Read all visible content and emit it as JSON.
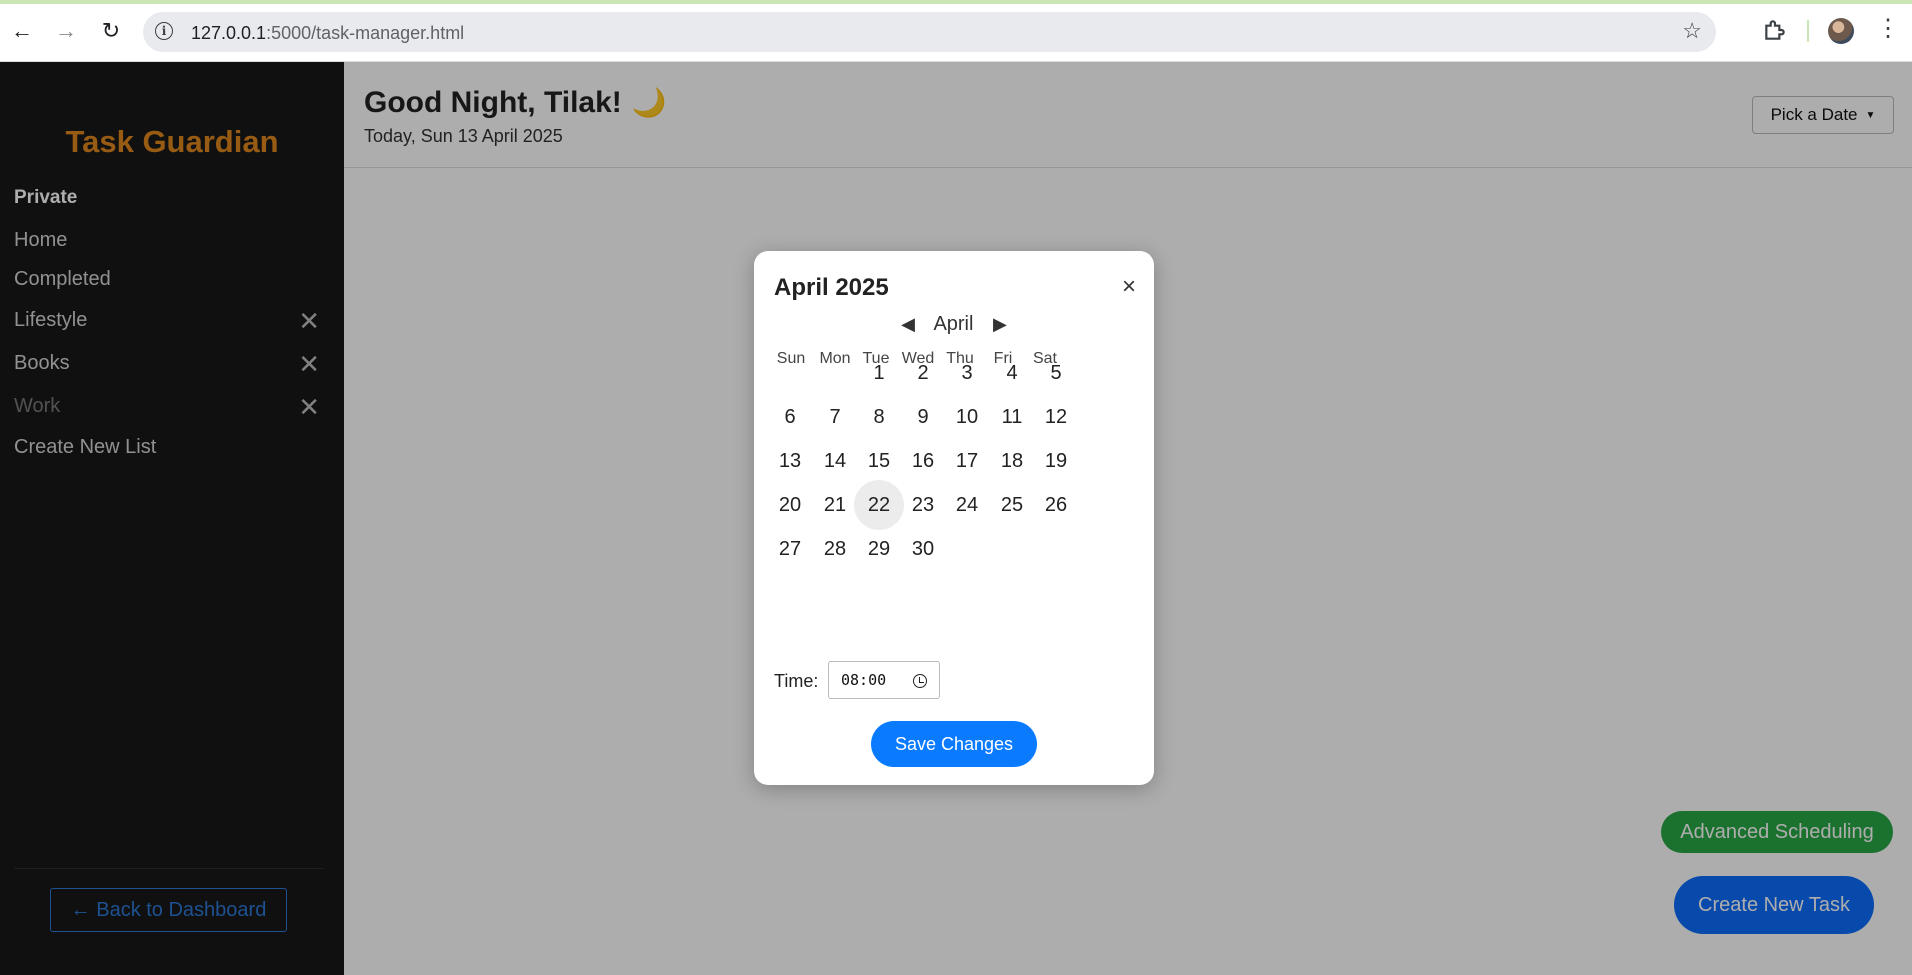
{
  "browser": {
    "url_host": "127.0.0.1",
    "url_path": ":5000/task-manager.html",
    "icons": [
      "back-arrow-icon",
      "forward-arrow-icon",
      "reload-icon",
      "site-info-icon",
      "bookmark-star-icon",
      "extensions-icon",
      "profile-avatar",
      "menu-kebab-icon"
    ]
  },
  "sidebar": {
    "brand": "Task Guardian",
    "section_heading": "Private",
    "items": [
      {
        "label": "Home",
        "removable": false
      },
      {
        "label": "Completed",
        "removable": false
      },
      {
        "label": "Lifestyle",
        "removable": true
      },
      {
        "label": "Books",
        "removable": true
      },
      {
        "label": "Work",
        "removable": true
      },
      {
        "label": "Create New List",
        "removable": false
      }
    ],
    "remove_glyph": "✕",
    "back_button": "← Back to Dashboard"
  },
  "header": {
    "greeting": "Good Night, Tilak!",
    "greeting_icon": "🌙",
    "date_line": "Today, Sun 13 April 2025",
    "pick_date_label": "Pick a Date"
  },
  "actions": {
    "advanced_scheduling": "Advanced Scheduling",
    "create_task": "Create New Task"
  },
  "modal": {
    "title": "April 2025",
    "close_glyph": "×",
    "month_label": "April",
    "prev_glyph": "◀",
    "next_glyph": "▶",
    "weekdays": [
      "Sun",
      "Mon",
      "Tue",
      "Wed",
      "Thu",
      "Fri",
      "Sat"
    ],
    "days": [
      [
        "",
        "",
        "1",
        "2",
        "3",
        "4",
        "5"
      ],
      [
        "6",
        "7",
        "8",
        "9",
        "10",
        "11",
        "12"
      ],
      [
        "13",
        "14",
        "15",
        "16",
        "17",
        "18",
        "19"
      ],
      [
        "20",
        "21",
        "22",
        "23",
        "24",
        "25",
        "26"
      ],
      [
        "27",
        "28",
        "29",
        "30",
        "",
        "",
        ""
      ]
    ],
    "selected_day": "22",
    "time_label": "Time:",
    "time_value": "08:00",
    "save_label": "Save Changes"
  },
  "colors": {
    "brand": "#e0861c",
    "sidebar_bg": "#181818",
    "primary": "#0d6efd",
    "success": "#28a745"
  }
}
